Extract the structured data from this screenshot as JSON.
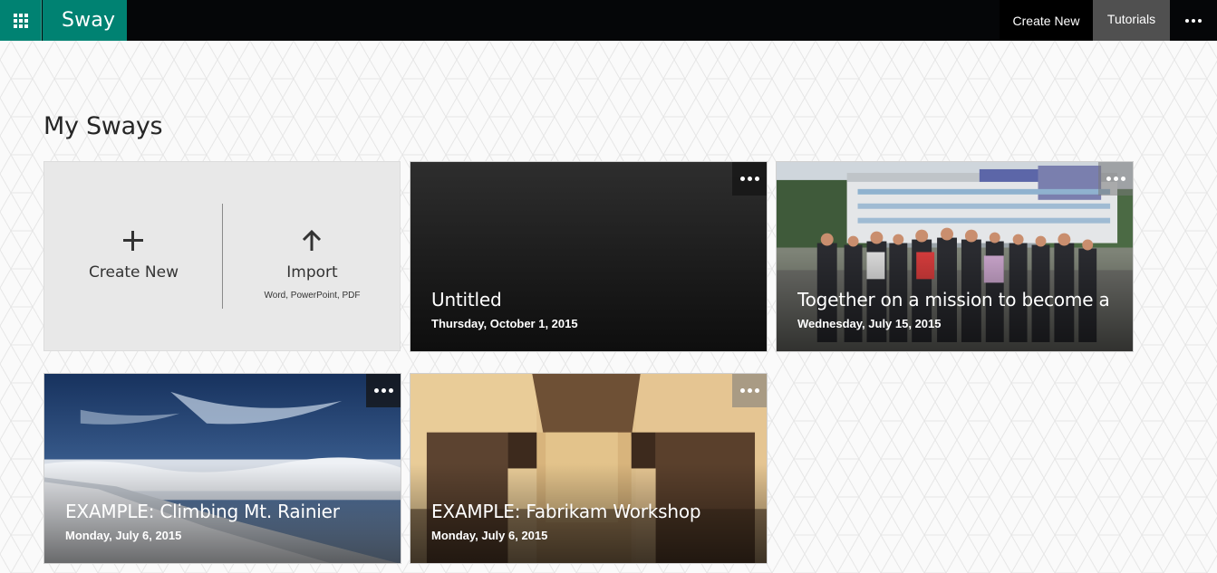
{
  "header": {
    "brand": "Sway",
    "create_new": "Create New",
    "tutorials": "Tutorials",
    "app_launcher_icon": "waffle-icon",
    "more_icon": "ellipsis-icon"
  },
  "main": {
    "title": "My Sways",
    "create_tile": {
      "create_label": "Create New",
      "create_icon": "plus-icon",
      "import_label": "Import",
      "import_icon": "arrow-up-icon",
      "import_subtitle": "Word, PowerPoint, PDF"
    },
    "sways": [
      {
        "title": "Untitled",
        "date": "Thursday, October 1, 2015",
        "image": "dark-gradient"
      },
      {
        "title": "Together on a mission to become a ...",
        "date": "Wednesday, July 15, 2015",
        "image": "group-photo-outdoors"
      },
      {
        "title": "EXAMPLE: Climbing Mt. Rainier",
        "date": "Monday, July 6, 2015",
        "image": "mountain-above-clouds"
      },
      {
        "title": "EXAMPLE: Fabrikam Workshop",
        "date": "Monday, July 6, 2015",
        "image": "wood-dovetail-joint"
      }
    ]
  },
  "colors": {
    "accent": "#008272",
    "topbar": "#050608",
    "tutorials_active": "#505050",
    "tile_bg": "#e8e8e8"
  }
}
